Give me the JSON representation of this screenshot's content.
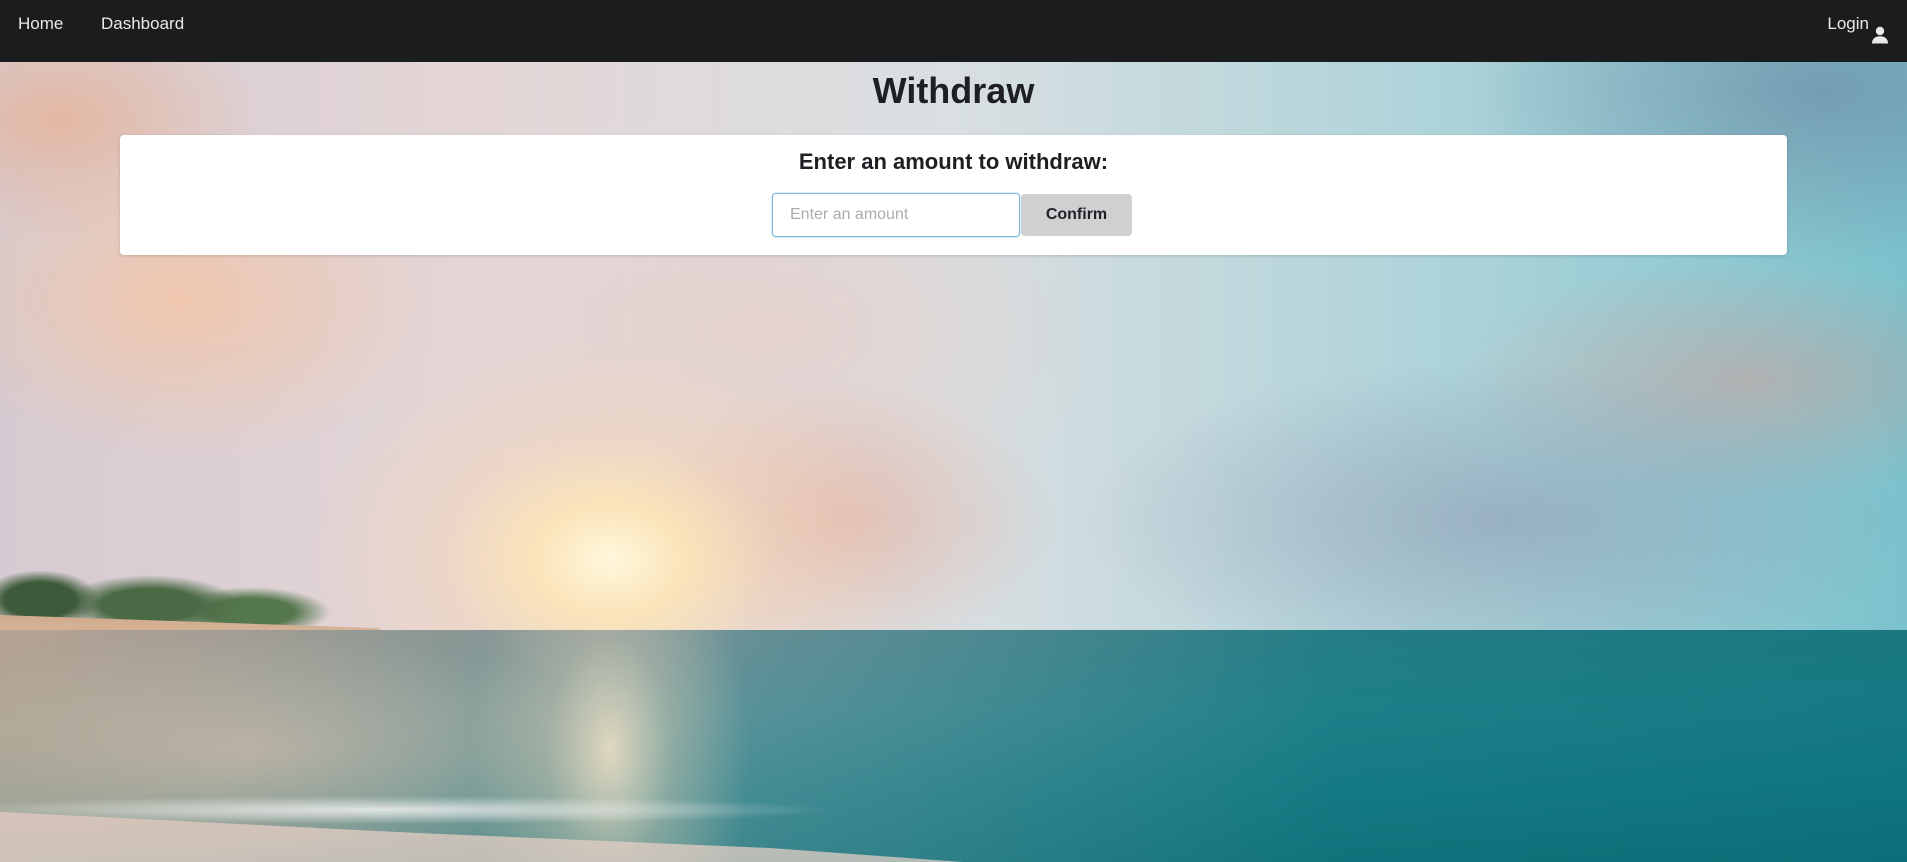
{
  "navbar": {
    "home_label": "Home",
    "dashboard_label": "Dashboard",
    "login_label": "Login",
    "login_icon": "user-icon"
  },
  "main": {
    "title": "Withdraw",
    "card": {
      "heading": "Enter an amount to withdraw:",
      "amount_input": {
        "value": "",
        "placeholder": "Enter an amount"
      },
      "confirm_label": "Confirm"
    }
  },
  "colors": {
    "navbar_bg": "#1b1c1e",
    "button_bg": "#cfd0d2",
    "input_border": "#7fb8da"
  }
}
